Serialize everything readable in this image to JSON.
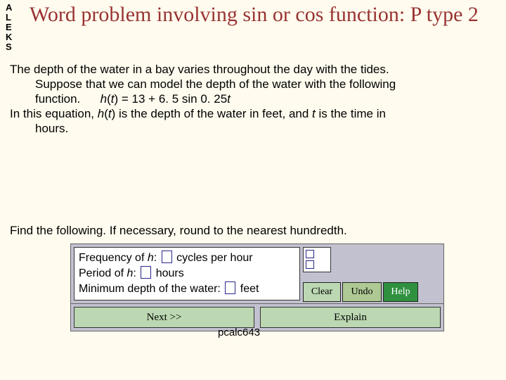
{
  "brand": {
    "l1": "A",
    "l2": "L",
    "l3": "E",
    "l4": "K",
    "l5": "S"
  },
  "title": "Word problem involving sin or cos function: P type 2",
  "problem": {
    "s1": "The depth of the water in a bay varies throughout the day with the tides.",
    "s2": "Suppose that we can model the depth of the water with the following",
    "s3pre": "function.",
    "eq": "h(t) = 13 + 6. 5 sin 0. 25t",
    "s4a": "In this equation, ",
    "s4b": "h",
    "s4c": "(",
    "s4d": "t",
    "s4e": ") is the depth of the water in feet, and ",
    "s4f": "t",
    "s4g": " is the time in",
    "s5": "hours."
  },
  "prompt": "Find the following. If necessary, round to the nearest hundredth.",
  "answers": {
    "freq_label_a": "Frequency of ",
    "freq_label_b": "h",
    "freq_label_c": ": ",
    "freq_units": " cycles per hour",
    "period_label_a": "Period of ",
    "period_label_b": "h",
    "period_label_c": ": ",
    "period_units": " hours",
    "min_label": "Minimum depth of the water: ",
    "min_units": " feet"
  },
  "buttons": {
    "clear": "Clear",
    "undo": "Undo",
    "help": "Help",
    "next": "Next >>",
    "explain": "Explain"
  },
  "footer": "pcalc643"
}
